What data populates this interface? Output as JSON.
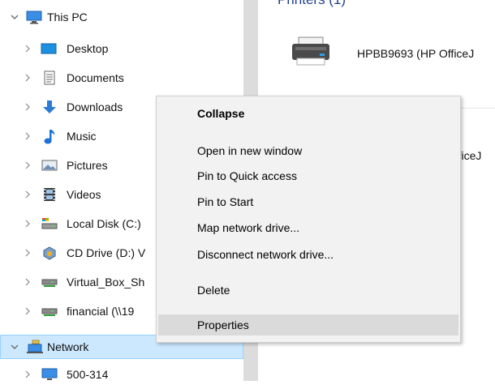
{
  "nav": {
    "items": [
      {
        "label": "This PC",
        "icon": "monitor-icon",
        "expanded": true
      },
      {
        "label": "Desktop",
        "icon": "desktop-icon"
      },
      {
        "label": "Documents",
        "icon": "documents-icon"
      },
      {
        "label": "Downloads",
        "icon": "download-icon"
      },
      {
        "label": "Music",
        "icon": "music-icon"
      },
      {
        "label": "Pictures",
        "icon": "pictures-icon"
      },
      {
        "label": "Videos",
        "icon": "videos-icon"
      },
      {
        "label": "Local Disk (C:)",
        "icon": "drive-icon"
      },
      {
        "label": "CD Drive (D:) V",
        "icon": "cd-drive-icon"
      },
      {
        "label": "Virtual_Box_Sh",
        "icon": "network-drive-icon"
      },
      {
        "label": "financial (\\\\19",
        "icon": "network-drive-icon"
      },
      {
        "label": "Network",
        "icon": "network-icon",
        "expanded": true,
        "selected": true
      },
      {
        "label": "500-314",
        "icon": "computer-icon"
      }
    ]
  },
  "content": {
    "group_header": "Printers (1)",
    "printer_name": "HPBB9693 (HP OfficeJ",
    "printer_name_2": "fficeJ"
  },
  "context_menu": {
    "items": [
      {
        "label": "Collapse",
        "bold": true
      },
      {
        "label": "Open in new window"
      },
      {
        "label": "Pin to Quick access"
      },
      {
        "label": "Pin to Start"
      },
      {
        "label": "Map network drive..."
      },
      {
        "label": "Disconnect network drive..."
      },
      {
        "label": "Delete"
      },
      {
        "label": "Properties",
        "hover": true
      }
    ]
  },
  "colors": {
    "selection": "#cce8ff",
    "menu_bg": "#f2f2f2",
    "menu_hover": "#dadada",
    "splitter": "#dcdcdc",
    "group_header": "#1f3f8f"
  }
}
